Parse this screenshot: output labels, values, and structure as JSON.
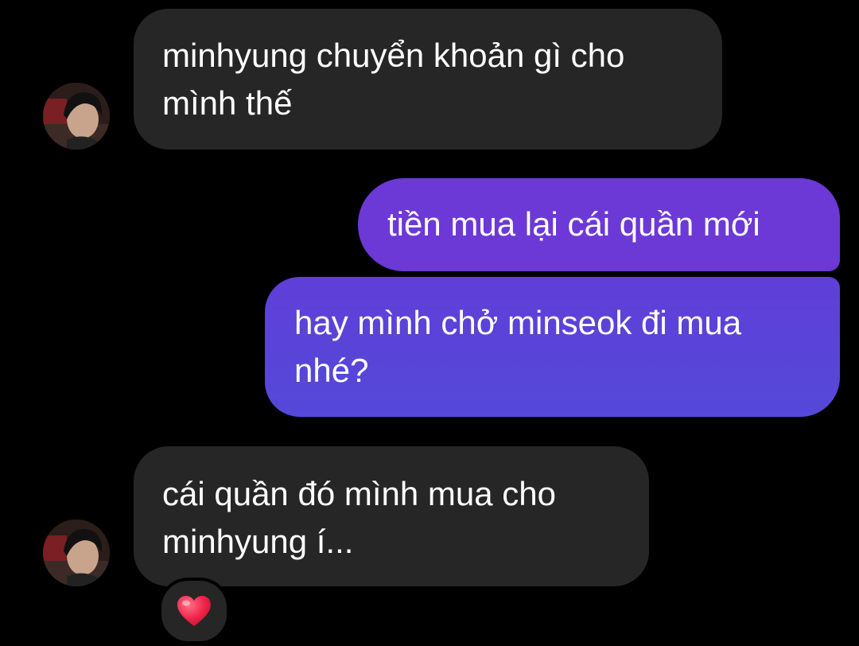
{
  "messages": [
    {
      "direction": "incoming",
      "text": "minhyung chuyển khoản gì cho\nmình thế"
    },
    {
      "direction": "outgoing",
      "text": "tiền mua lại cái quần mới"
    },
    {
      "direction": "outgoing",
      "text": "hay mình chở minseok đi mua\nnhé?"
    },
    {
      "direction": "incoming",
      "text": "cái quần đó mình mua cho\nminhyung í...",
      "reaction_icon": "red-heart-icon"
    }
  ],
  "colors": {
    "background": "#000000",
    "incoming_bubble": "#262626",
    "outgoing_bubble_top": "#6c38d6",
    "outgoing_bubble_bottom": "#5449d8",
    "text": "#ffffff",
    "reaction_heart": "#f0264c"
  },
  "icons": {
    "sender_avatar": "profile-photo-avatar",
    "reaction": "red-heart-icon"
  }
}
